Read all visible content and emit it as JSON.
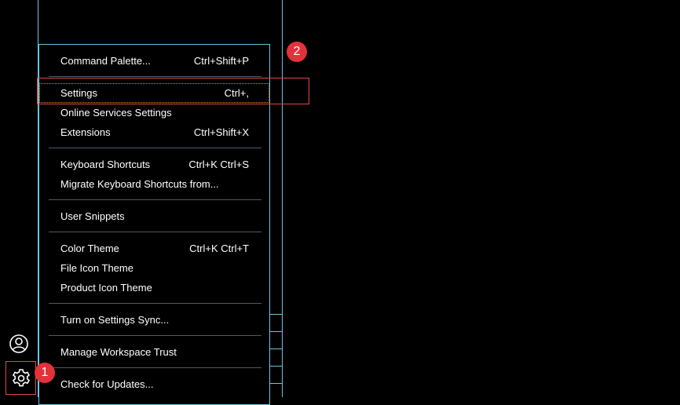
{
  "menu": {
    "groups": [
      [
        {
          "label": "Command Palette...",
          "key": "Ctrl+Shift+P"
        }
      ],
      [
        {
          "label": "Settings",
          "key": "Ctrl+,"
        },
        {
          "label": "Online Services Settings",
          "key": ""
        },
        {
          "label": "Extensions",
          "key": "Ctrl+Shift+X"
        }
      ],
      [
        {
          "label": "Keyboard Shortcuts",
          "key": "Ctrl+K Ctrl+S"
        },
        {
          "label": "Migrate Keyboard Shortcuts from...",
          "key": ""
        }
      ],
      [
        {
          "label": "User Snippets",
          "key": ""
        }
      ],
      [
        {
          "label": "Color Theme",
          "key": "Ctrl+K Ctrl+T"
        },
        {
          "label": "File Icon Theme",
          "key": ""
        },
        {
          "label": "Product Icon Theme",
          "key": ""
        }
      ],
      [
        {
          "label": "Turn on Settings Sync...",
          "key": ""
        }
      ],
      [
        {
          "label": "Manage Workspace Trust",
          "key": ""
        }
      ],
      [
        {
          "label": "Check for Updates...",
          "key": ""
        }
      ]
    ]
  },
  "callouts": {
    "one": "1",
    "two": "2"
  },
  "activity_bar": {
    "icons": [
      "account-icon",
      "gear-icon"
    ]
  },
  "colors": {
    "border": "#6fc3df",
    "callout": "#e2333a",
    "highlight": "#e2464f",
    "focus": "#f38518"
  }
}
